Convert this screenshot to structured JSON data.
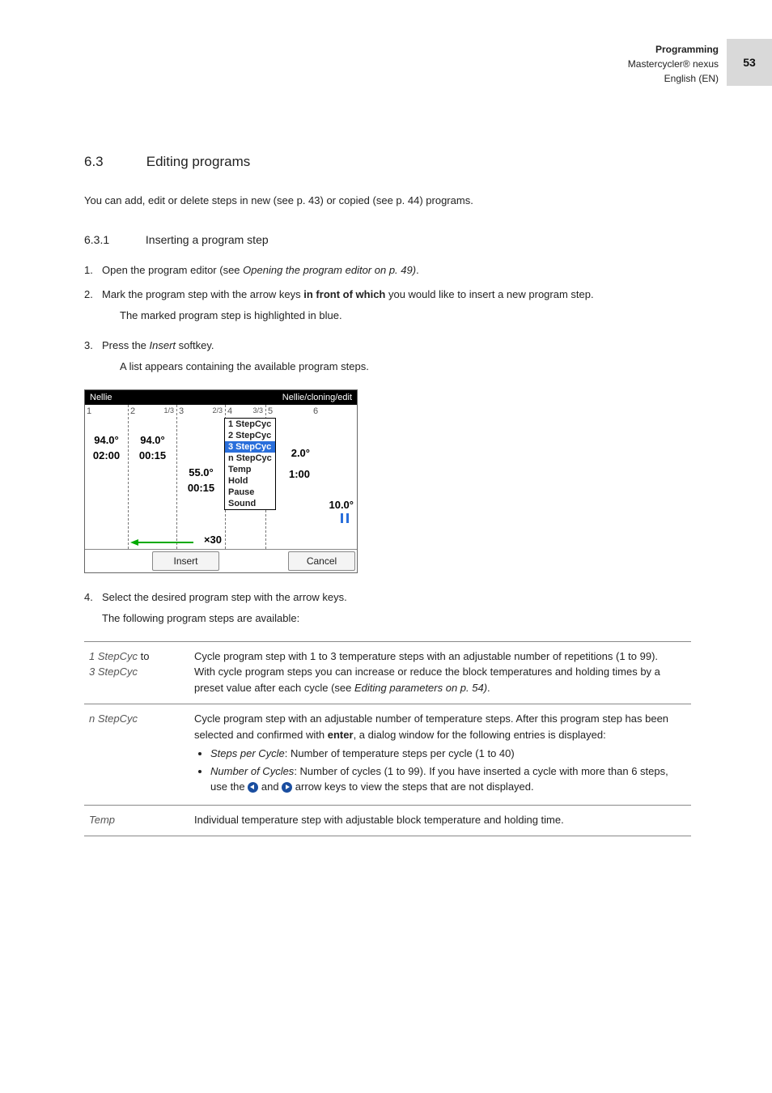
{
  "header": {
    "section": "Programming",
    "product": "Mastercycler® nexus",
    "lang": "English (EN)",
    "page": "53"
  },
  "sec63": {
    "num": "6.3",
    "title": "Editing programs",
    "intro": "You can add, edit or delete steps in new (see p. 43) or copied (see p. 44) programs."
  },
  "sec631": {
    "num": "6.3.1",
    "title": "Inserting a program step",
    "step1_pre": "Open the program editor (see ",
    "step1_ref": "Opening the program editor on p. 49)",
    "step1_post": ".",
    "step2_pre": "Mark the program step with the arrow keys ",
    "step2_bold": "in front of which",
    "step2_post": " you would like to insert a new program step.",
    "step2_sub": "The marked program step is highlighted in blue.",
    "step3_pre": "Press the ",
    "step3_em": "Insert",
    "step3_post": " softkey.",
    "step3_sub": "A list appears containing the available program steps.",
    "step4": "Select the desired program step with the arrow keys.",
    "step4_sub": "The following program steps are available:"
  },
  "device": {
    "user": "Nellie",
    "path": "Nellie/cloning/edit",
    "cols": {
      "c1": "1",
      "c2": "2",
      "c3": "3",
      "c4": "4",
      "c5": "5",
      "c6": "6",
      "f13a": "1/3",
      "f23": "2/3",
      "f33": "3/3"
    },
    "vals": {
      "t1": "94.0°",
      "d1": "02:00",
      "t2": "94.0°",
      "d2": "00:15",
      "t3": "55.0°",
      "d3": "00:15",
      "t5": "2.0°",
      "d5": "1:00",
      "t6": "10.0°",
      "x30": "×30"
    },
    "menu": {
      "m1": "1 StepCyc",
      "m2": "2 StepCyc",
      "m3": "3 StepCyc",
      "m4": "n StepCyc",
      "m5": "Temp",
      "m6": "Hold",
      "m7": "Pause",
      "m8": "Sound"
    },
    "soft_insert": "Insert",
    "soft_cancel": "Cancel"
  },
  "table": {
    "r1": {
      "label_a": "1 StepCyc",
      "label_mid": " to",
      "label_b": "3 StepCyc",
      "desc1": "Cycle program step with 1 to 3 temperature steps with an adjustable number of repetitions (1 to 99).",
      "desc2_pre": "With cycle program steps you can increase or reduce the block temperatures and holding times by a preset value after each cycle  (see ",
      "desc2_em": "Editing parameters on p. 54)",
      "desc2_post": "."
    },
    "r2": {
      "label": "n StepCyc",
      "desc_pre": "Cycle program step with an adjustable number of temperature steps. After this program step has been selected and confirmed with ",
      "desc_bold": "enter",
      "desc_post": ", a dialog window for the following entries is displayed:",
      "li1_em": "Steps per Cycle",
      "li1_post": ": Number of temperature steps per cycle (1 to 40)",
      "li2_em": "Number of Cycles",
      "li2_mid": ": Number of cycles (1 to 99). If you have inserted a cycle with more than 6 steps, use the ",
      "li2_post": " arrow keys to view the steps that are not displayed."
    },
    "r3": {
      "label": "Temp",
      "desc": "Individual temperature step with adjustable block temperature and holding time."
    }
  }
}
